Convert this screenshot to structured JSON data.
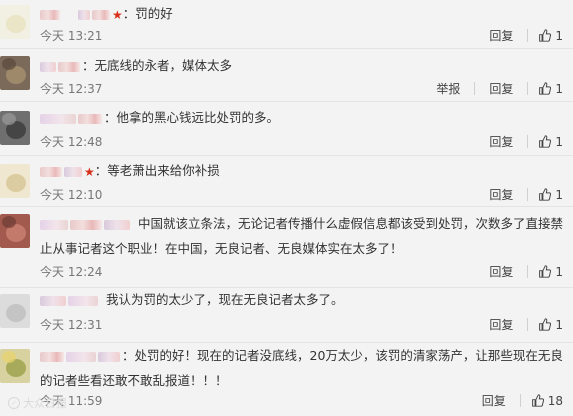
{
  "comments": [
    {
      "text": "：罚的好",
      "time": "今天 13:21",
      "actions": [
        "回复"
      ],
      "likes": "1",
      "badge": "★"
    },
    {
      "text": "：无底线的永者，媒体太多",
      "time": "今天 12:37",
      "actions": [
        "举报",
        "回复"
      ],
      "likes": "1"
    },
    {
      "text": "：他拿的黑心钱远比处罚的多。",
      "time": "今天 12:48",
      "actions": [
        "回复"
      ],
      "likes": "1"
    },
    {
      "text": "：等老萧出来给你补损",
      "time": "今天 12:10",
      "actions": [
        "回复"
      ],
      "likes": "1",
      "badge": "★"
    },
    {
      "text": "中国就该立条法，无论记者传播什么虚假信息都该受到处罚，次数多了直接禁止从事记者这个职业！在中国，无良记者、无良媒体实在太多了！",
      "time": "今天 12:24",
      "actions": [
        "回复"
      ],
      "likes": "1"
    },
    {
      "text": "我认为罚的太少了，现在无良记者太多了。",
      "time": "今天 12:31",
      "actions": [
        "回复"
      ],
      "likes": "1"
    },
    {
      "text": "：处罚的好！现在的记者没底线，20万太少，该罚的清家荡产，让那些现在无良的记者些看还敢不敢乱报道！！！",
      "time": "今天 11:59",
      "actions": [
        "回复"
      ],
      "likes": "18"
    }
  ],
  "watermark": "大众日报",
  "colors": {
    "star": "#d7301a",
    "time": "#777777",
    "background": "#f3f3f3"
  }
}
